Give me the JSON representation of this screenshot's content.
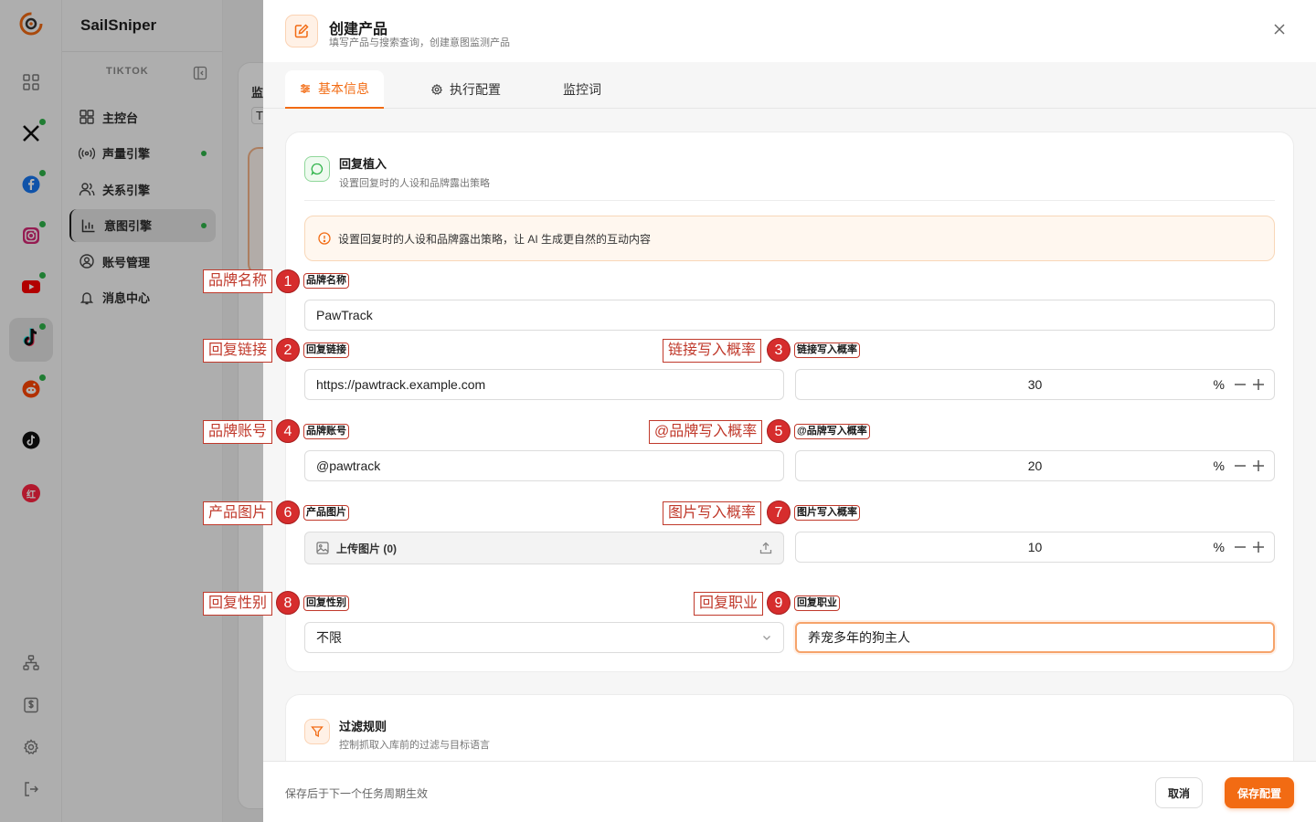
{
  "app": {
    "name": "SailSniper"
  },
  "colors": {
    "accent": "#f26b13",
    "status_online": "#2fb34a",
    "annotation": "#c0392b"
  },
  "rail": {
    "items": [
      {
        "icon": "grid-icon",
        "dot": false
      },
      {
        "icon": "x-logo-icon",
        "dot": true
      },
      {
        "icon": "facebook-icon",
        "dot": true
      },
      {
        "icon": "instagram-icon",
        "dot": true
      },
      {
        "icon": "youtube-icon",
        "dot": true
      },
      {
        "icon": "tiktok-icon",
        "dot": true,
        "active": true
      },
      {
        "icon": "reddit-icon",
        "dot": true
      },
      {
        "icon": "tiktok-alt-icon",
        "dot": false
      },
      {
        "icon": "xiaohongshu-icon",
        "dot": false,
        "text": "红"
      }
    ],
    "bottom": [
      "org-chart-icon",
      "billing-icon",
      "settings-icon",
      "logout-icon"
    ]
  },
  "sidebar": {
    "section": "TIKTOK",
    "items": [
      {
        "label": "主控台",
        "icon": "dashboard-icon",
        "dot": false
      },
      {
        "label": "声量引擎",
        "icon": "broadcast-icon",
        "dot": true
      },
      {
        "label": "关系引擎",
        "icon": "users-icon",
        "dot": false
      },
      {
        "label": "意图引擎",
        "icon": "bar-chart-icon",
        "dot": true,
        "active": true
      },
      {
        "label": "账号管理",
        "icon": "account-icon",
        "dot": false
      },
      {
        "label": "消息中心",
        "icon": "bell-icon",
        "dot": false
      }
    ]
  },
  "background": {
    "card_title": "监",
    "card_sub": "T"
  },
  "drawer": {
    "title": "创建产品",
    "subtitle": "填写产品与搜索查询，创建意图监测产品",
    "tabs": [
      {
        "label": "基本信息",
        "active": true
      },
      {
        "label": "执行配置",
        "active": false
      },
      {
        "label": "监控词",
        "active": false
      }
    ],
    "reply": {
      "title": "回复植入",
      "subtitle": "设置回复时的人设和品牌露出策略",
      "notice": "设置回复时的人设和品牌露出策略，让 AI 生成更自然的互动内容",
      "brand_name": {
        "label": "品牌名称",
        "value": "PawTrack"
      },
      "reply_link": {
        "label": "回复链接",
        "value": "https://pawtrack.example.com"
      },
      "link_rate": {
        "label": "链接写入概率",
        "value": "30",
        "unit": "%"
      },
      "brand_account": {
        "label": "品牌账号",
        "value": "@pawtrack"
      },
      "mention_rate": {
        "label": "@品牌写入概率",
        "value": "20",
        "unit": "%"
      },
      "product_image": {
        "label": "产品图片",
        "button": "上传图片 (0)"
      },
      "image_rate": {
        "label": "图片写入概率",
        "value": "10",
        "unit": "%"
      },
      "gender": {
        "label": "回复性别",
        "value": "不限"
      },
      "profession": {
        "label": "回复职业",
        "value": "养宠多年的狗主人"
      }
    },
    "filter": {
      "title": "过滤规则",
      "subtitle": "控制抓取入库前的过滤与目标语言"
    },
    "footer": {
      "note": "保存后于下一个任务周期生效",
      "cancel": "取消",
      "save": "保存配置"
    }
  },
  "annotations": [
    {
      "num": "1",
      "text": "品牌名称"
    },
    {
      "num": "2",
      "text": "回复链接"
    },
    {
      "num": "3",
      "text": "链接写入概率"
    },
    {
      "num": "4",
      "text": "品牌账号"
    },
    {
      "num": "5",
      "text": "@品牌写入概率"
    },
    {
      "num": "6",
      "text": "产品图片"
    },
    {
      "num": "7",
      "text": "图片写入概率"
    },
    {
      "num": "8",
      "text": "回复性别"
    },
    {
      "num": "9",
      "text": "回复职业"
    }
  ]
}
